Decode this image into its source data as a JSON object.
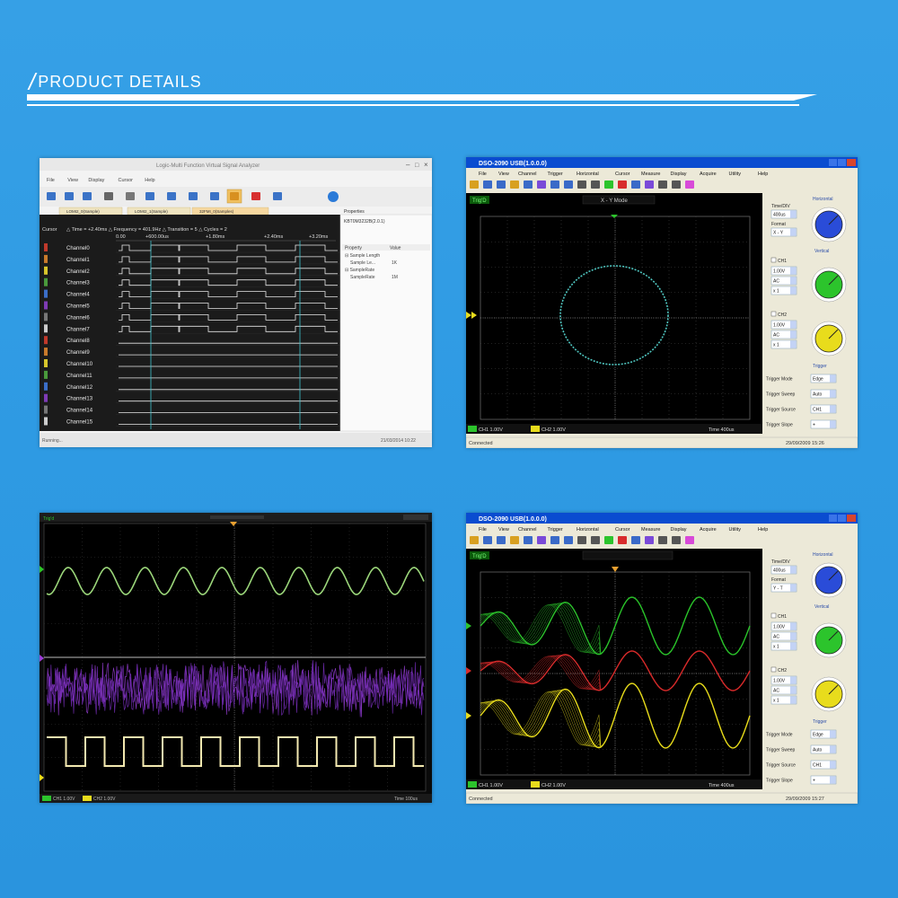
{
  "header": {
    "title": "PRODUCT DETAILS"
  },
  "la": {
    "title": "Logic-Multi Function Virtual Signal Analyzer",
    "menu": [
      "File",
      "View",
      "Display",
      "Cursor",
      "Help"
    ],
    "tabs": [
      "LOMI2_0(Sample)",
      "LOMI2_1(Sample)",
      "32FMI_0(Samples)"
    ],
    "cursor_label": "Cursor",
    "measure": "△ Time = +2.40ms   △ Frequency = 401.9Hz   △ Transition = 5   △ Cycles = 2",
    "ticks": [
      "0.00",
      "+600.00us",
      "+1.80ms",
      "+2.40ms",
      "+3.20ms"
    ],
    "channels": [
      "Channel0",
      "Channel1",
      "Channel2",
      "Channel3",
      "Channel4",
      "Channel5",
      "Channel6",
      "Channel7",
      "Channel8",
      "Channel9",
      "Channel10",
      "Channel11",
      "Channel12",
      "Channel13",
      "Channel14",
      "Channel15"
    ],
    "channel_colors": [
      "#c0392b",
      "#c97a2b",
      "#d8c52b",
      "#4a9a3b",
      "#3b6ec7",
      "#7e3bb5",
      "#777777",
      "#cccccc",
      "#c0392b",
      "#c97a2b",
      "#d8c52b",
      "#4a9a3b",
      "#3b6ec7",
      "#7e3bb5",
      "#777777",
      "#cccccc"
    ],
    "properties_title": "Properties",
    "properties_device": "KBT0M3232B(2.0.1)",
    "prop_headers": [
      "Property",
      "Value"
    ],
    "props": [
      [
        "Sample Length",
        ""
      ],
      [
        "Sample Le...",
        "1K"
      ],
      [
        "SampleRate",
        ""
      ],
      [
        "SampleRate",
        "1M"
      ]
    ],
    "status_left": "Running...",
    "status_right": "21/03/2014  10:22"
  },
  "osc1": {
    "title": "DSO-2090 USB(1.0.0.0)",
    "menu": [
      "File",
      "View",
      "Channel",
      "Trigger",
      "Horizontal",
      "Cursor",
      "Measure",
      "Display",
      "Acquire",
      "Utility",
      "Help"
    ],
    "status_trig": "Trig'D",
    "mode_label": "X - Y Mode",
    "ch1_volt": "CH1   1.00V",
    "ch2_volt": "CH2   1.00V",
    "time_label": "Time   400us",
    "statusbar": "Connected",
    "datetime": "29/09/2009   15:26",
    "panel": {
      "horizontal": "Horizontal",
      "time_div_label": "Time/DIV",
      "time_div": "400us",
      "format_label": "Format",
      "format": "X - Y",
      "vertical": "Vertical",
      "ch1_label": "CH1",
      "ch1_volts": "1.00V",
      "ch1_coupling": "AC",
      "ch1_probe": "x 1",
      "ch2_label": "CH2",
      "ch2_volts": "1.00V",
      "ch2_coupling": "AC",
      "ch2_probe": "x 1",
      "trigger": "Trigger",
      "trig_rows": [
        [
          "Trigger Mode",
          "Edge"
        ],
        [
          "Trigger Sweep",
          "Auto"
        ],
        [
          "Trigger Source",
          "CH1"
        ],
        [
          "Trigger Slope",
          "+"
        ]
      ]
    },
    "knob_colors": [
      "#2a4cd8",
      "#2cc42c",
      "#e8dc1c"
    ]
  },
  "scope3": {
    "status_trig": "Trig'd",
    "ch1_label": "CH1   1.00V",
    "ch2_label": "CH2   1.00V",
    "time_label": "Time   100us"
  },
  "osc2": {
    "title": "DSO-2090 USB(1.0.0.0)",
    "menu": [
      "File",
      "View",
      "Channel",
      "Trigger",
      "Horizontal",
      "Cursor",
      "Measure",
      "Display",
      "Acquire",
      "Utility",
      "Help"
    ],
    "status_trig": "Trig'D",
    "ch1_volt": "CH1   1.00V",
    "ch2_volt": "CH2   1.00V",
    "time_label": "Time   400us",
    "statusbar": "Connected",
    "datetime": "29/09/2009   15:27",
    "panel": {
      "horizontal": "Horizontal",
      "time_div_label": "Time/DIV",
      "time_div": "400us",
      "format_label": "Format",
      "format": "Y - T",
      "vertical": "Vertical",
      "ch1_label": "CH1",
      "ch1_volts": "1.00V",
      "ch1_coupling": "AC",
      "ch1_probe": "x 1",
      "ch2_label": "CH2",
      "ch2_volts": "1.00V",
      "ch2_coupling": "AC",
      "ch2_probe": "x 1",
      "trigger": "Trigger",
      "trig_rows": [
        [
          "Trigger Mode",
          "Edge"
        ],
        [
          "Trigger Sweep",
          "Auto"
        ],
        [
          "Trigger Source",
          "CH1"
        ],
        [
          "Trigger Slope",
          "+"
        ]
      ]
    },
    "knob_colors": [
      "#2a4cd8",
      "#2cc42c",
      "#e8dc1c"
    ]
  }
}
